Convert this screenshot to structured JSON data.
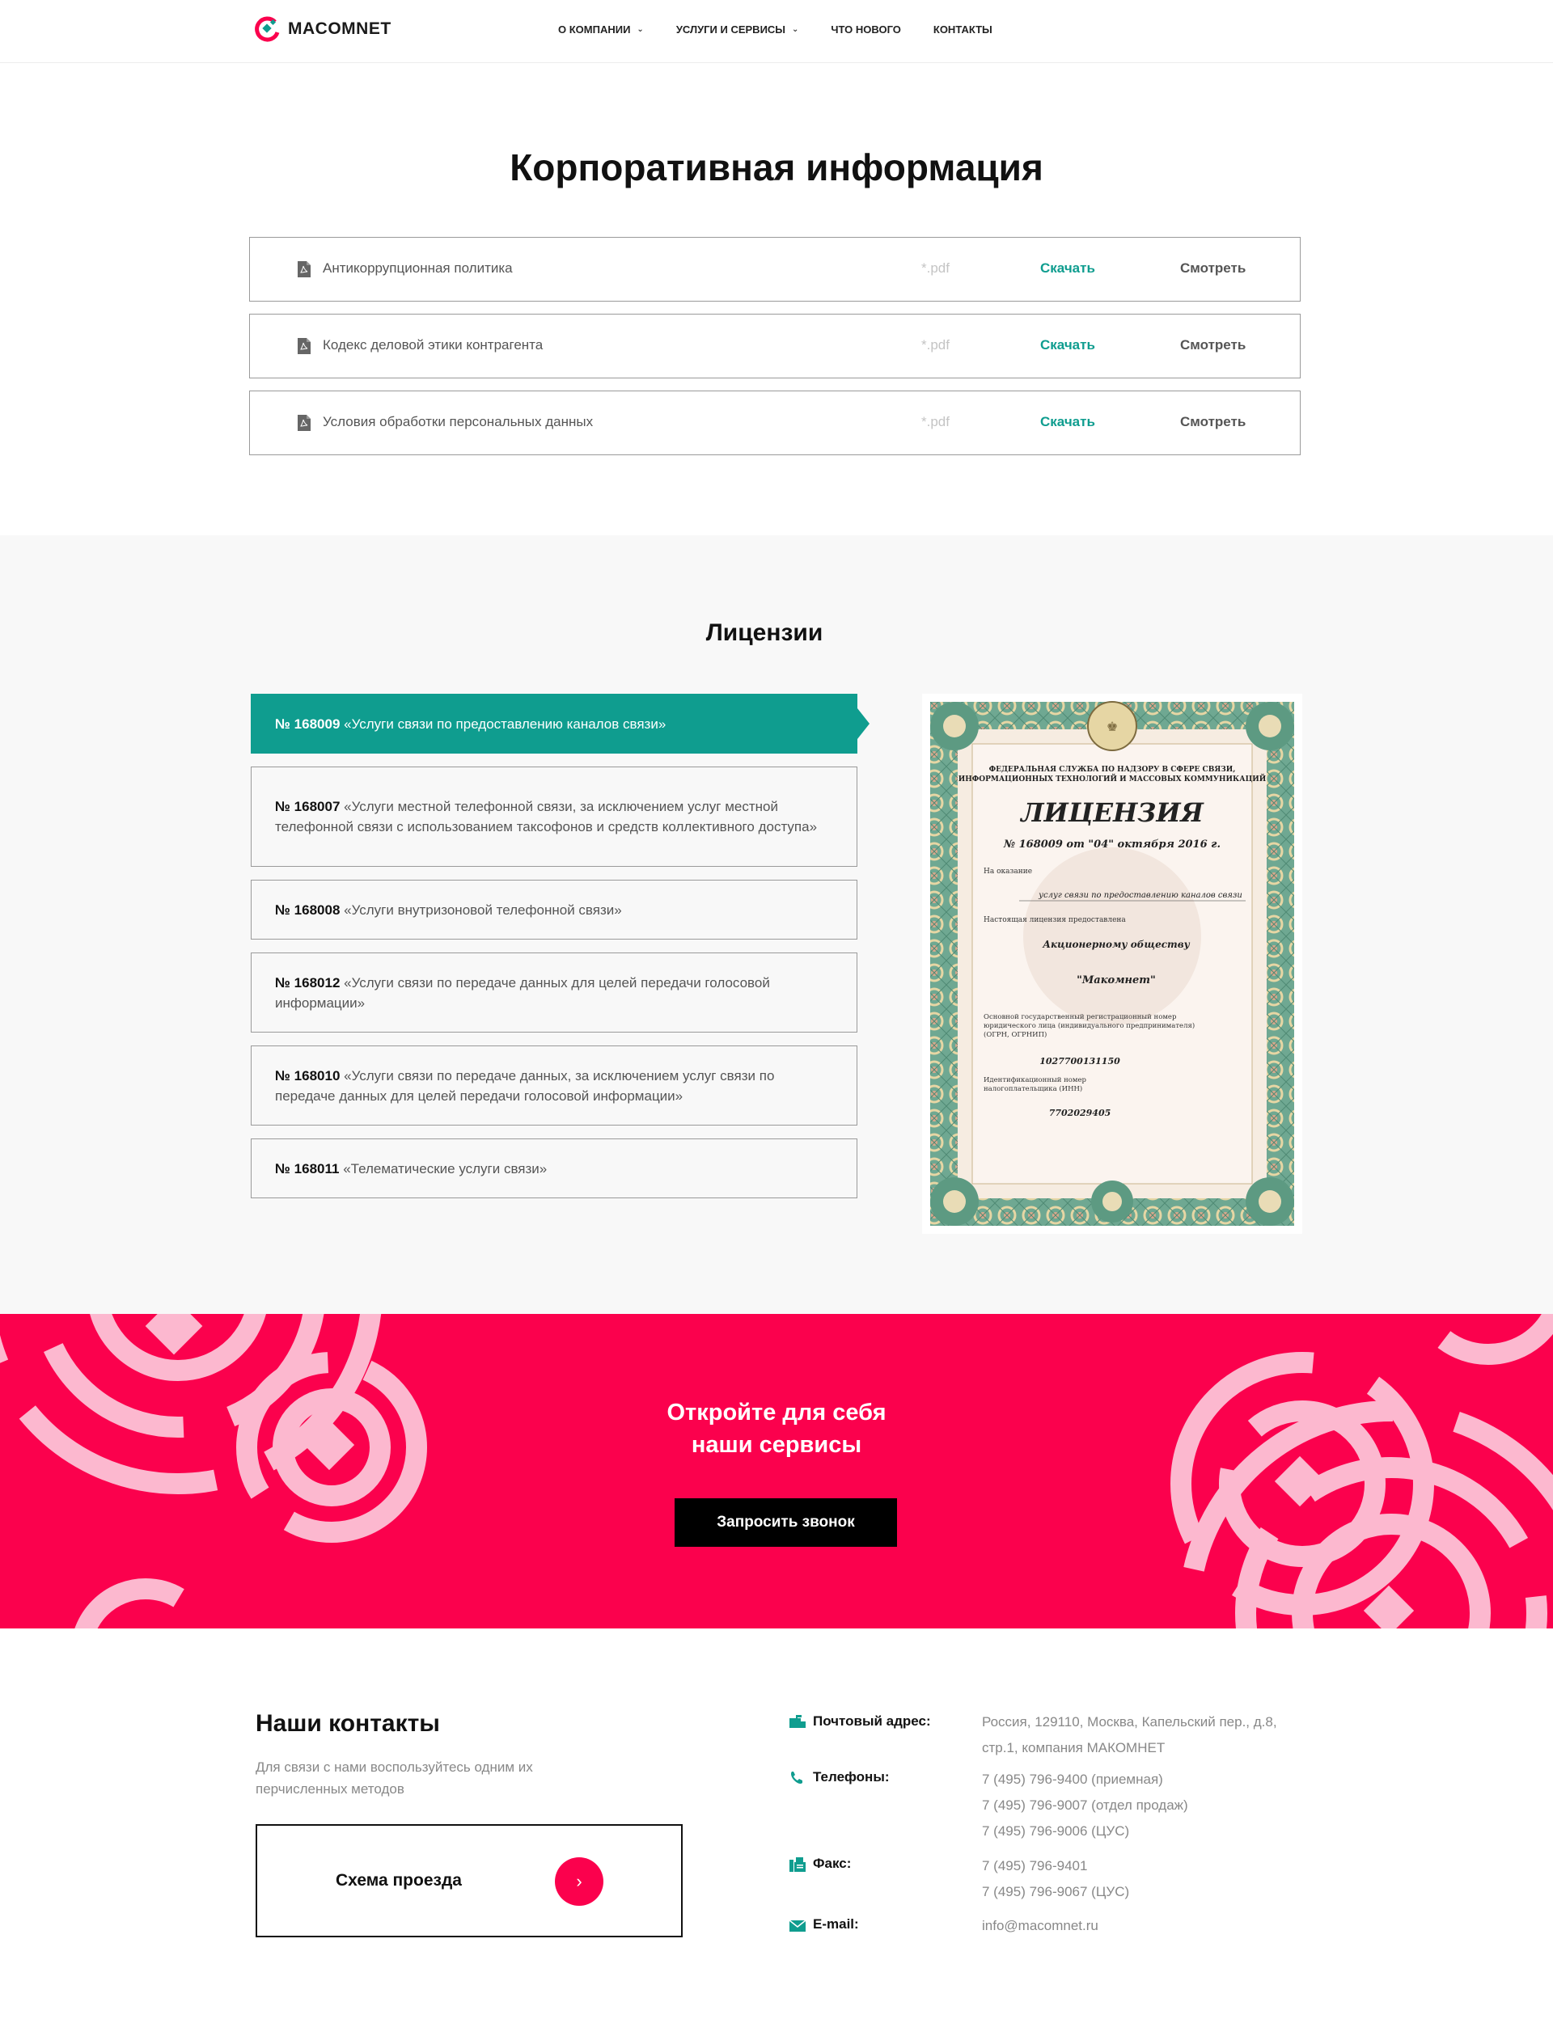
{
  "header": {
    "logo_text": "MACOMNET",
    "nav": [
      {
        "label": "О КОМПАНИИ",
        "dropdown": true
      },
      {
        "label": "УСЛУГИ И СЕРВИСЫ",
        "dropdown": true
      },
      {
        "label": "ЧТО НОВОГО",
        "dropdown": false
      },
      {
        "label": "КОНТАКТЫ",
        "dropdown": false
      }
    ]
  },
  "corporate": {
    "title": "Корпоративная информация",
    "documents": [
      {
        "name": "Антикоррупционная политика",
        "ext": "*.pdf",
        "download": "Скачать",
        "view": "Смотреть"
      },
      {
        "name": "Кодекс деловой этики контрагента",
        "ext": "*.pdf",
        "download": "Скачать",
        "view": "Смотреть"
      },
      {
        "name": "Условия обработки персональных данных",
        "ext": "*.pdf",
        "download": "Скачать",
        "view": "Смотреть"
      }
    ]
  },
  "licenses": {
    "title": "Лицензии",
    "items": [
      {
        "number": "№ 168009",
        "text": " «Услуги связи по предоставлению каналов связи»",
        "active": true
      },
      {
        "number": "№ 168007",
        "text": " «Услуги местной телефонной связи, за исключением услуг местной телефонной связи с использованием таксофонов и средств коллективного доступа»",
        "active": false
      },
      {
        "number": "№ 168008",
        "text": " «Услуги внутризоновой телефонной связи»",
        "active": false
      },
      {
        "number": "№ 168012",
        "text": " «Услуги связи по передаче данных для целей передачи голосовой информации»",
        "active": false
      },
      {
        "number": "№ 168010",
        "text": " «Услуги связи по передаче данных, за исключением услуг связи по передаче данных для целей передачи голосовой информации»",
        "active": false
      },
      {
        "number": "№ 168011",
        "text": " «Телематические услуги связи»",
        "active": false
      }
    ],
    "certificate": {
      "agency": "ФЕДЕРАЛЬНАЯ СЛУЖБА ПО НАДЗОРУ В СФЕРЕ СВЯЗИ, ИНФОРМАЦИОННЫХ ТЕХНОЛОГИЙ И МАССОВЫХ КОММУНИКАЦИЙ",
      "heading": "ЛИЦЕНЗИЯ",
      "number_line": "№ 168009 от \"04\" октября 2016 г.",
      "on_label": "На оказание",
      "service": "услуг связи по предоставлению каналов связи",
      "issued_label": "Настоящая лицензия предоставлена",
      "holder_type": "Акционерному обществу",
      "holder_name": "\"Макомнет\"",
      "ogrn_label": "Основной государственный регистрационный номер юридического лица (индивидуального предпринимателя) (ОГРН, ОГРНИП)",
      "ogrn": "1027700131150",
      "inn_label": "Идентификационный номер налогоплательщика (ИНН)",
      "inn": "7702029405"
    }
  },
  "cta": {
    "title_line1": "Откройте для себя",
    "title_line2": "наши сервисы",
    "button": "Запросить звонок"
  },
  "contacts": {
    "title": "Наши контакты",
    "subtitle": "Для связи с нами воспользуйтесь одним их перчисленных методов",
    "route_label": "Схема проезда",
    "address_label": "Почтовый адрес:",
    "address_line1": "Россия, 129110, Москва, Капельский пер., д.8,",
    "address_line2": "стр.1, компания МАКОМНЕТ",
    "phones_label": "Телефоны:",
    "phones": [
      "7 (495) 796-9400 (приемная)",
      "7 (495) 796-9007 (отдел продаж)",
      "7 (495) 796-9006 (ЦУС)"
    ],
    "fax_label": "Факс:",
    "faxes": [
      "7 (495) 796-9401",
      "7 (495) 796-9067 (ЦУС)"
    ],
    "email_label": "E-mail:",
    "email": "info@macomnet.ru"
  },
  "colors": {
    "accent_teal": "#0f9d8f",
    "brand_pink": "#fb014d",
    "pattern_pink": "#fcb8cf"
  }
}
